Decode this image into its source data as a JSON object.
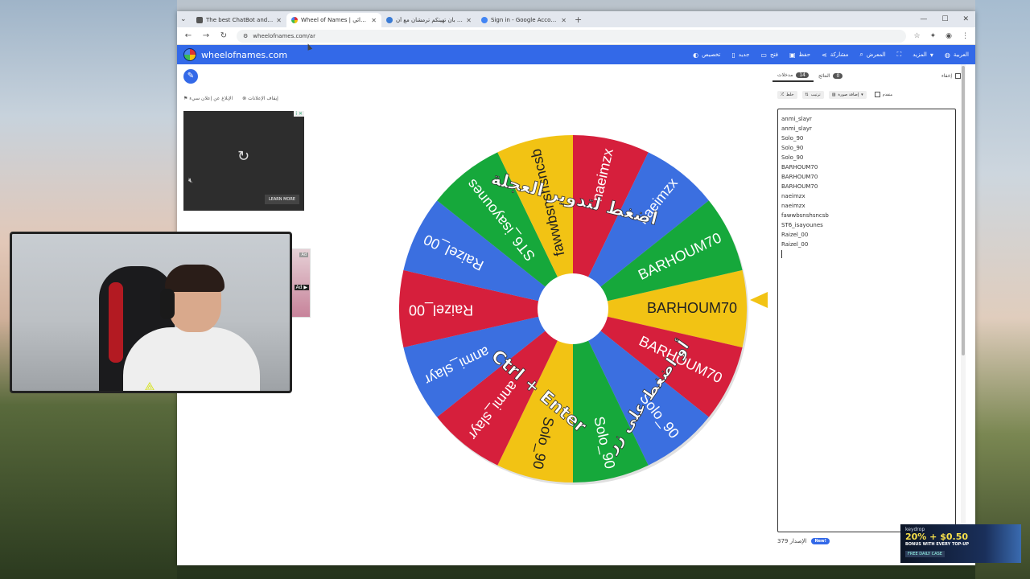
{
  "browser": {
    "tabs": [
      {
        "title": "The best ChatBot and Widgets"
      },
      {
        "title": "Wheel of Names | عجلة الاسم العشوائي"
      },
      {
        "title": "مقياس بان تهيتكم ترمشان مع أن"
      },
      {
        "title": "Sign in - Google Accounts"
      }
    ],
    "url": "wheelofnames.com/ar"
  },
  "site": {
    "name": "wheelofnames.com",
    "menu": [
      "تخصيص",
      "جديد",
      "فتح",
      "حفظ",
      "مشاركة",
      "المعرض",
      "المزيد",
      "العربية"
    ]
  },
  "left": {
    "adlinks": [
      "إيقاف الإعلانات",
      "الإبلاغ عن إعلان سيء"
    ],
    "ad_learn": "LEARN MORE",
    "ad_small_label": "Ad"
  },
  "wheel": {
    "instructions": [
      "اضغط لتدوير العجلة",
      "أو اضغط على زر",
      "Ctrl + Enter"
    ],
    "segments": [
      {
        "label": "BARHOUM70",
        "color": "#f2c314"
      },
      {
        "label": "BARHOUM70",
        "color": "#d61f3c"
      },
      {
        "label": "Solo_90",
        "color": "#3b6fe0"
      },
      {
        "label": "Solo_90",
        "color": "#16a83b"
      },
      {
        "label": "Solo_90",
        "color": "#f2c314"
      },
      {
        "label": "anmi_slayr",
        "color": "#d61f3c"
      },
      {
        "label": "anmi_slayr",
        "color": "#3b6fe0"
      },
      {
        "label": "Raizel_00",
        "color": "#d61f3c"
      },
      {
        "label": "Raizel_00",
        "color": "#3b6fe0"
      },
      {
        "label": "ST6_isayounes",
        "color": "#16a83b"
      },
      {
        "label": "fawwbsnshsncsb",
        "color": "#f2c314"
      },
      {
        "label": "naeimzx",
        "color": "#d61f3c"
      },
      {
        "label": "naeimzx",
        "color": "#3b6fe0"
      },
      {
        "label": "BARHOUM70",
        "color": "#16a83b"
      }
    ]
  },
  "panel": {
    "tab_entries": "مدخلات",
    "entries_count": "14",
    "tab_results": "النتائج",
    "results_count": "0",
    "hide": "إخفاء",
    "tools": [
      "خلط",
      "ترتيب",
      "إضافة صورة",
      "متقدم"
    ],
    "entries": [
      "anmi_slayr",
      "anmi_slayr",
      "Solo_90",
      "Solo_90",
      "Solo_90",
      "BARHOUM70",
      "BARHOUM70",
      "BARHOUM70",
      "naeimzx",
      "naeimzx",
      "fawwbsnshsncsb",
      "ST6_isayounes",
      "Raizel_00",
      "Raizel_00"
    ],
    "version_label": "الإصدار 379",
    "new_label": "New!"
  },
  "overlay": {
    "keydrop_brand": "keydrop",
    "keydrop_promo": "20% + $0.50",
    "keydrop_sub": "BONUS WITH EVERY TOP-UP",
    "keydrop_case": "FREE DAILY CASE"
  }
}
